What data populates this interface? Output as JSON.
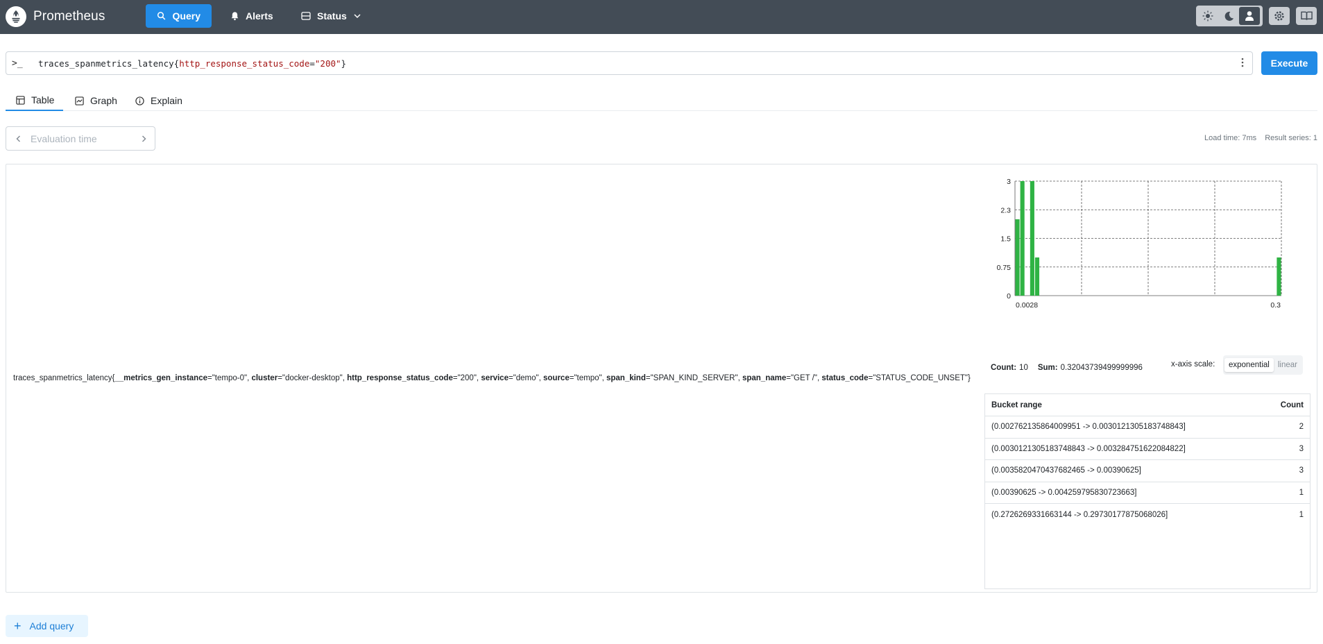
{
  "header": {
    "app_title": "Prometheus",
    "nav": [
      {
        "label": "Query",
        "icon": "search-icon",
        "active": true
      },
      {
        "label": "Alerts",
        "icon": "bell-icon",
        "active": false
      },
      {
        "label": "Status",
        "icon": "server-icon",
        "active": false,
        "has_dropdown": true
      }
    ],
    "theme_options": [
      "light-theme-icon",
      "dark-theme-icon",
      "auto-theme-icon"
    ],
    "theme_selected": "auto-theme-icon",
    "accent_color": "#228be6",
    "header_color": "#434c56"
  },
  "query": {
    "prompt": ">_",
    "metric": "traces_spanmetrics_latency",
    "open_brace": "{",
    "label_name": "http_response_status_code",
    "equals": "=",
    "label_value": "\"200\"",
    "close_brace": "}",
    "execute_label": "Execute"
  },
  "tabs": [
    {
      "label": "Table",
      "icon": "table-icon",
      "active": true
    },
    {
      "label": "Graph",
      "icon": "graph-icon",
      "active": false
    },
    {
      "label": "Explain",
      "icon": "info-icon",
      "active": false
    }
  ],
  "eval_time": {
    "placeholder": "Evaluation time"
  },
  "stats": {
    "load_time": "Load time: 7ms",
    "result_series": "Result series: 1"
  },
  "series": {
    "metric": "traces_spanmetrics_latency{",
    "labels": [
      {
        "name": "__metrics_gen_instance",
        "value": "\"tempo-0\"",
        "sep": ", "
      },
      {
        "name": "cluster",
        "value": "\"docker-desktop\"",
        "sep": ", "
      },
      {
        "name": "http_response_status_code",
        "value": "\"200\"",
        "sep": ", "
      },
      {
        "name": "service",
        "value": "\"demo\"",
        "sep": ", "
      },
      {
        "name": "source",
        "value": "\"tempo\"",
        "sep": ", "
      },
      {
        "name": "span_kind",
        "value": "\"SPAN_KIND_SERVER\"",
        "sep": ", "
      },
      {
        "name": "span_name",
        "value": "\"GET /\"",
        "sep": ", "
      },
      {
        "name": "status_code",
        "value": "\"STATUS_CODE_UNSET\"",
        "sep": ""
      }
    ],
    "close": "}"
  },
  "histogram": {
    "count_label": "Count:",
    "count_value": "10",
    "sum_label": "Sum:",
    "sum_value": "0.32043739499999996",
    "scale_label": "x-axis scale:",
    "scale_options": [
      "exponential",
      "linear"
    ],
    "scale_selected": "exponential",
    "table_headers": {
      "range": "Bucket range",
      "count": "Count"
    },
    "buckets": [
      {
        "range": "(0.002762135864009951 -> 0.0030121305183748843]",
        "count": "2"
      },
      {
        "range": "(0.0030121305183748843 -> 0.003284751622084822]",
        "count": "3"
      },
      {
        "range": "(0.0035820470437682465 -> 0.00390625]",
        "count": "3"
      },
      {
        "range": "(0.00390625 -> 0.004259795830723663]",
        "count": "1"
      },
      {
        "range": "(0.2726269331663144 -> 0.29730177875068026]",
        "count": "1"
      }
    ],
    "bar_color": "#2fb344"
  },
  "chart_data": {
    "type": "bar",
    "x_scale": "exponential",
    "x_ticks": [
      "0.0028",
      "0.3"
    ],
    "y_ticks": [
      "0",
      "0.75",
      "1.5",
      "2.3",
      "3"
    ],
    "ylim": [
      0,
      3
    ],
    "xlim": [
      0.002762135864009951,
      0.29730177875068026
    ],
    "grid": true,
    "series": [
      {
        "values": [
          {
            "lo": 0.002762135864009951,
            "hi": 0.0030121305183748843,
            "count": 2
          },
          {
            "lo": 0.0030121305183748843,
            "hi": 0.003284751622084822,
            "count": 3
          },
          {
            "lo": 0.0035820470437682465,
            "hi": 0.00390625,
            "count": 3
          },
          {
            "lo": 0.00390625,
            "hi": 0.004259795830723663,
            "count": 1
          },
          {
            "lo": 0.2726269331663144,
            "hi": 0.29730177875068026,
            "count": 1
          }
        ]
      }
    ]
  },
  "add_query": {
    "label": "Add query"
  }
}
